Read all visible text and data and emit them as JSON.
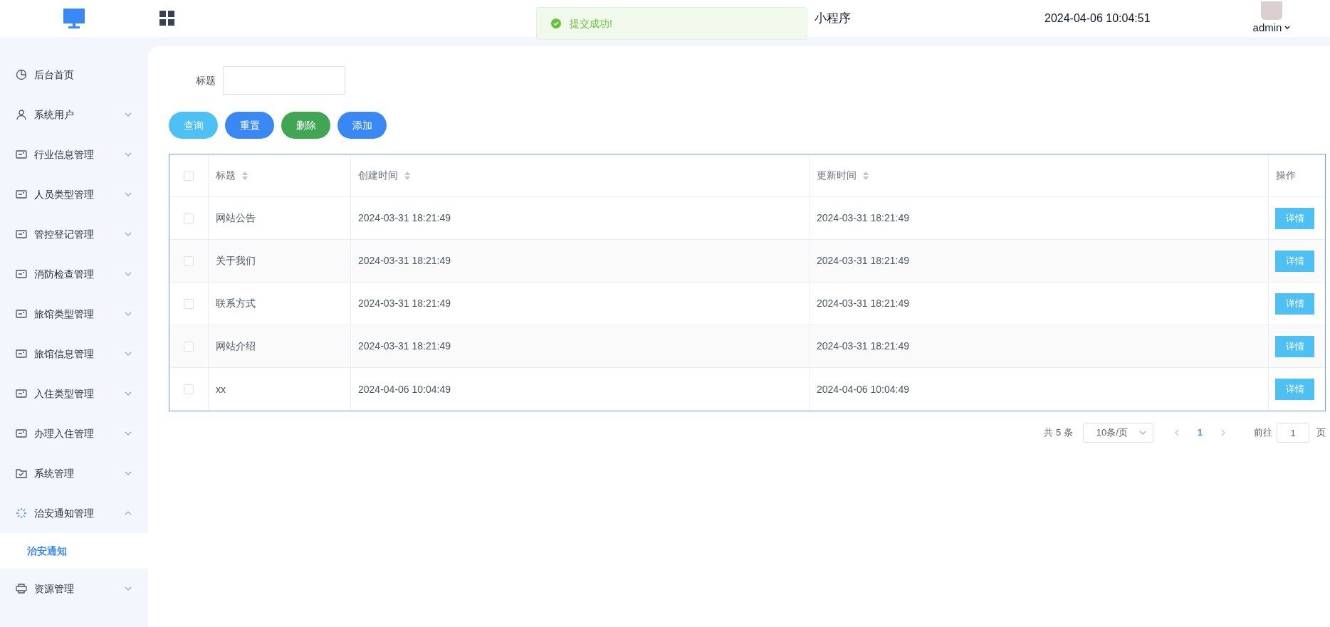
{
  "header": {
    "title": "小程序",
    "datetime": "2024-04-06 10:04:51",
    "user": "admin"
  },
  "toast": {
    "message": "提交成功!"
  },
  "sidebar": {
    "items": [
      {
        "label": "后台首页",
        "kind": "link"
      },
      {
        "label": "系统用户",
        "kind": "submenu",
        "expanded": false
      },
      {
        "label": "行业信息管理",
        "kind": "submenu",
        "expanded": false
      },
      {
        "label": "人员类型管理",
        "kind": "submenu",
        "expanded": false
      },
      {
        "label": "管控登记管理",
        "kind": "submenu",
        "expanded": false
      },
      {
        "label": "消防检查管理",
        "kind": "submenu",
        "expanded": false
      },
      {
        "label": "旅馆类型管理",
        "kind": "submenu",
        "expanded": false
      },
      {
        "label": "旅馆信息管理",
        "kind": "submenu",
        "expanded": false
      },
      {
        "label": "入住类型管理",
        "kind": "submenu",
        "expanded": false
      },
      {
        "label": "办理入住管理",
        "kind": "submenu",
        "expanded": false
      },
      {
        "label": "系统管理",
        "kind": "submenu",
        "expanded": false
      },
      {
        "label": "治安通知管理",
        "kind": "submenu",
        "expanded": true,
        "children": [
          {
            "label": "治安通知",
            "selected": true
          }
        ]
      },
      {
        "label": "资源管理",
        "kind": "submenu",
        "expanded": false
      }
    ]
  },
  "search": {
    "label": "标题"
  },
  "buttons": [
    {
      "label": "查询",
      "color": "#4fc0f3"
    },
    {
      "label": "重置",
      "color": "#3a88f5"
    },
    {
      "label": "删除",
      "color": "#41a553"
    },
    {
      "label": "添加",
      "color": "#3a88f5"
    }
  ],
  "table": {
    "all_checked": false,
    "columns": [
      "标题",
      "创建时间",
      "更新时间",
      "操作"
    ],
    "rows": [
      {
        "checked": false,
        "title": "网站公告",
        "created": "2024-03-31 18:21:49",
        "updated": "2024-03-31 18:21:49",
        "action": "详情"
      },
      {
        "checked": false,
        "title": "关于我们",
        "created": "2024-03-31 18:21:49",
        "updated": "2024-03-31 18:21:49",
        "action": "详情"
      },
      {
        "checked": false,
        "title": "联系方式",
        "created": "2024-03-31 18:21:49",
        "updated": "2024-03-31 18:21:49",
        "action": "详情"
      },
      {
        "checked": false,
        "title": "网站介绍",
        "created": "2024-03-31 18:21:49",
        "updated": "2024-03-31 18:21:49",
        "action": "详情"
      },
      {
        "checked": false,
        "title": "xx",
        "created": "2024-04-06 10:04:49",
        "updated": "2024-04-06 10:04:49",
        "action": "详情"
      }
    ]
  },
  "pagination": {
    "total": "共 5 条",
    "page_size": "10条/页",
    "pages": [
      {
        "label": "1",
        "selected": true
      }
    ],
    "goto_label": "前往",
    "goto_value": "1",
    "goto_suffix": "页"
  }
}
